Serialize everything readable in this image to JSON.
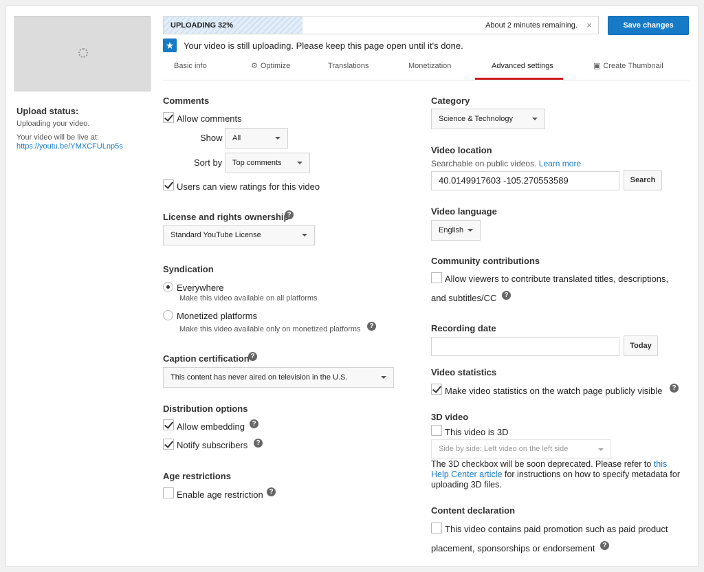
{
  "upload_panel": {
    "status_title": "Upload status:",
    "status_text": "Uploading your video.",
    "live_text": "Your video will be live at:",
    "live_url": "https://youtu.be/YMXCFULnp5s"
  },
  "progress": {
    "label": "UPLOADING 32%",
    "percent": 32,
    "remaining": "About 2 minutes remaining.",
    "close_icon": "×"
  },
  "save_button": "Save changes",
  "notice": "Your video is still uploading. Please keep this page open until it's done.",
  "tabs": [
    {
      "label": "Basic info"
    },
    {
      "label": "Optimize",
      "icon": "optimize-icon"
    },
    {
      "label": "Translations"
    },
    {
      "label": "Monetization"
    },
    {
      "label": "Advanced settings",
      "active": true
    },
    {
      "label": "Create Thumbnail",
      "icon": "thumbnail-icon"
    }
  ],
  "comments": {
    "title": "Comments",
    "allow_label": "Allow comments",
    "allow_checked": true,
    "show_label": "Show",
    "show_value": "All",
    "sort_label": "Sort by",
    "sort_value": "Top comments",
    "ratings_label": "Users can view ratings for this video",
    "ratings_checked": true
  },
  "license": {
    "title": "License and rights ownership",
    "value": "Standard YouTube License"
  },
  "syndication": {
    "title": "Syndication",
    "options": [
      {
        "label": "Everywhere",
        "desc": "Make this video available on all platforms",
        "checked": true
      },
      {
        "label": "Monetized platforms",
        "desc": "Make this video available only on monetized platforms",
        "checked": false
      }
    ]
  },
  "caption": {
    "title": "Caption certification",
    "value": "This content has never aired on television in the U.S."
  },
  "distribution": {
    "title": "Distribution options",
    "embedding_label": "Allow embedding",
    "notify_label": "Notify subscribers"
  },
  "age": {
    "title": "Age restrictions",
    "label": "Enable age restriction"
  },
  "category": {
    "title": "Category",
    "value": "Science & Technology"
  },
  "location": {
    "title": "Video location",
    "hint": "Searchable on public videos.",
    "learn_more": "Learn more",
    "value": "40.0149917603 -105.270553589",
    "search_button": "Search"
  },
  "language": {
    "title": "Video language",
    "value": "English"
  },
  "community": {
    "title": "Community contributions",
    "label_line1": "Allow viewers to contribute translated titles, descriptions,",
    "label_line2": "and subtitles/CC"
  },
  "recording": {
    "title": "Recording date",
    "value": "",
    "today_button": "Today"
  },
  "statistics": {
    "title": "Video statistics",
    "label": "Make video statistics on the watch page publicly visible"
  },
  "video3d": {
    "title": "3D video",
    "label": "This video is 3D",
    "select_value": "Side by side: Left video on the left side",
    "note_part1": "The 3D checkbox will be soon deprecated. Please refer to",
    "note_link": "this Help Center article",
    "note_part2": "for instructions on how to specify metadata for uploading 3D files."
  },
  "content_declaration": {
    "title": "Content declaration",
    "label_line1": "This video contains paid promotion such as paid product",
    "label_line2": "placement, sponsorships or endorsement"
  },
  "help_glyph": "?"
}
